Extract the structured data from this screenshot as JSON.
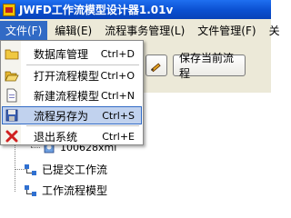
{
  "window": {
    "title": "JWFD工作流模型设计器1.01v"
  },
  "menubar": {
    "items": [
      {
        "label": "文件(F)"
      },
      {
        "label": "编辑(E)"
      },
      {
        "label": "流程事务管理(L)"
      },
      {
        "label": "文件管理(F)"
      },
      {
        "label": "关"
      }
    ]
  },
  "toolbar": {
    "save_current_label": "保存当前流程"
  },
  "file_menu": {
    "items": [
      {
        "label": "数据库管理",
        "shortcut": "Ctrl+D",
        "icon": "database-folder-icon"
      },
      {
        "label": "打开流程模型",
        "shortcut": "Ctrl+O",
        "icon": "open-folder-icon"
      },
      {
        "label": "新建流程模型",
        "shortcut": "Ctrl+N",
        "icon": "new-document-icon"
      },
      {
        "label": "流程另存为",
        "shortcut": "Ctrl+S",
        "icon": "floppy-disk-icon"
      },
      {
        "label": "退出系统",
        "shortcut": "Ctrl+E",
        "icon": "exit-x-icon"
      }
    ]
  },
  "tree": {
    "items": [
      {
        "label": "100628xml"
      },
      {
        "label": "已提交工作流"
      },
      {
        "label": "工作流程模型"
      }
    ]
  },
  "colors": {
    "title_bar": "#0a4fd0",
    "menu_highlight": "#316ac5",
    "selected_item": "#c1d2ee"
  }
}
